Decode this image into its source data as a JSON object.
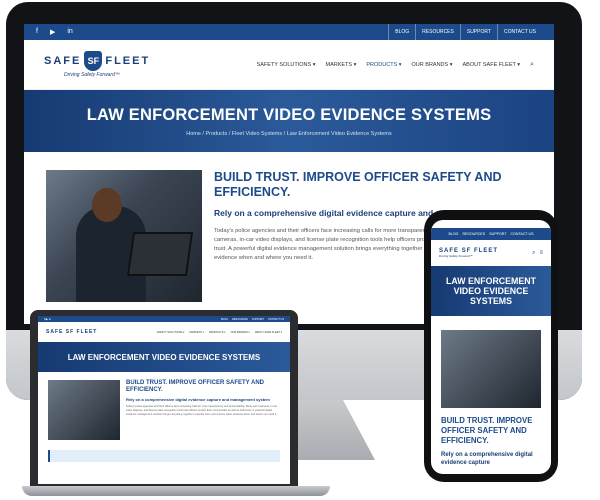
{
  "site": {
    "logo_left": "SAFE",
    "logo_right": "FLEET",
    "logo_mark": "SF",
    "tagline": "Driving Safety Forward™"
  },
  "topbar": {
    "social_icons": [
      "facebook-icon",
      "youtube-icon",
      "linkedin-icon"
    ],
    "social_glyphs": [
      "f",
      "▶",
      "in"
    ],
    "links": [
      "BLOG",
      "RESOURCES",
      "SUPPORT",
      "CONTACT US"
    ]
  },
  "nav": {
    "items": [
      {
        "label": "SAFETY SOLUTIONS ▾",
        "active": false
      },
      {
        "label": "MARKETS ▾",
        "active": false
      },
      {
        "label": "PRODUCTS ▾",
        "active": true
      },
      {
        "label": "OUR BRANDS ▾",
        "active": false
      },
      {
        "label": "ABOUT SAFE FLEET ▾",
        "active": false
      }
    ],
    "search_glyph": "⌕"
  },
  "hero": {
    "title": "LAW ENFORCEMENT VIDEO EVIDENCE SYSTEMS",
    "breadcrumb": "Home / Products / Fleet Video Systems / Law Enforcement Video Evidence Systems"
  },
  "content": {
    "heading": "BUILD TRUST. IMPROVE OFFICER SAFETY AND EFFICIENCY.",
    "subheading": "Rely on a comprehensive digital evidence capture and management system",
    "paragraph": "Today's police agencies and their officers face increasing calls for more transparency and accountability. Body-worn cameras, in-car video displays, and license plate recognition tools help officers protect their communities as well as build trust. A powerful digital evidence management solution brings everything together to quickly store and retrieve video evidence when and where you need it."
  },
  "phone": {
    "menu_glyph": "≡",
    "heading": "BUILD TRUST. IMPROVE OFFICER SAFETY AND EFFICIENCY.",
    "subheading": "Rely on a comprehensive digital evidence capture"
  },
  "colors": {
    "brand_blue": "#1d4a8a",
    "navy": "#1a3f7a"
  }
}
